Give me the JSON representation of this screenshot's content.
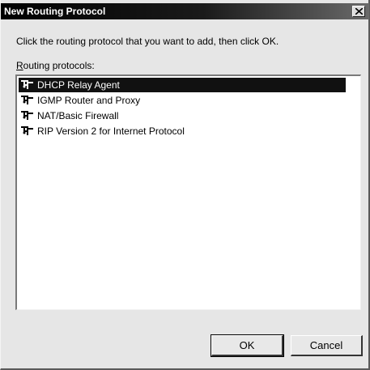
{
  "dialog": {
    "title": "New Routing Protocol",
    "instruction": "Click the routing protocol that you want to add, then click OK.",
    "list_label_accel": "R",
    "list_label_rest": "outing protocols:",
    "protocols": [
      {
        "label": "DHCP Relay Agent",
        "selected": true
      },
      {
        "label": "IGMP Router and Proxy",
        "selected": false
      },
      {
        "label": "NAT/Basic Firewall",
        "selected": false
      },
      {
        "label": "RIP Version 2 for Internet Protocol",
        "selected": false
      }
    ],
    "ok_label": "OK",
    "cancel_label": "Cancel"
  },
  "icons": {
    "close": "close-icon",
    "protocol": "router-icon"
  },
  "colors": {
    "selection": "#111111",
    "dialog_bg": "#e6e6e6"
  }
}
